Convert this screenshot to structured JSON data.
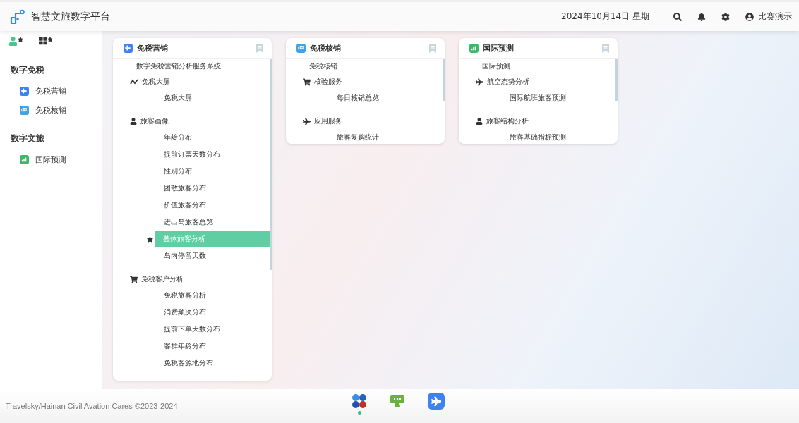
{
  "header": {
    "title": "智慧文旅数字平台",
    "date": "2024年10月14日 星期一",
    "user": "比赛演示"
  },
  "sidebar": {
    "sections": [
      {
        "title": "数字免税",
        "items": [
          {
            "label": "免税营销",
            "kind": "plane"
          },
          {
            "label": "免税核销",
            "kind": "ticket"
          }
        ]
      },
      {
        "title": "数字文旅",
        "items": [
          {
            "label": "国际预测",
            "kind": "chart"
          }
        ]
      }
    ]
  },
  "cards": [
    {
      "title": "免税营销",
      "kind": "plane",
      "system": "数字免税营销分析服务系统",
      "groups": [
        {
          "label": "免税大屏",
          "kind": "line",
          "items": [
            {
              "label": "免税大屏",
              "selected": false
            }
          ]
        },
        {
          "label": "旅客画像",
          "kind": "user",
          "items": [
            {
              "label": "年龄分布",
              "selected": false
            },
            {
              "label": "提前订票天数分布",
              "selected": false
            },
            {
              "label": "性别分布",
              "selected": false
            },
            {
              "label": "团散旅客分布",
              "selected": false
            },
            {
              "label": "价值旅客分布",
              "selected": false
            },
            {
              "label": "进出岛旅客总览",
              "selected": false
            },
            {
              "label": "整体旅客分析",
              "selected": true
            },
            {
              "label": "岛内停留天数",
              "selected": false
            }
          ]
        },
        {
          "label": "免税客户分析",
          "kind": "cart",
          "items": [
            {
              "label": "免税旅客分析",
              "selected": false
            },
            {
              "label": "消费频次分布",
              "selected": false
            },
            {
              "label": "提前下单天数分布",
              "selected": false
            },
            {
              "label": "客群年龄分布",
              "selected": false
            },
            {
              "label": "免税客源地分布",
              "selected": false
            }
          ]
        }
      ]
    },
    {
      "title": "免税核销",
      "kind": "ticket",
      "system": "免税核销",
      "groups": [
        {
          "label": "核验服务",
          "kind": "cart",
          "items": [
            {
              "label": "每日核销总览",
              "selected": false
            }
          ]
        },
        {
          "label": "应用服务",
          "kind": "plane",
          "items": [
            {
              "label": "旅客复购统计",
              "selected": false
            }
          ]
        }
      ]
    },
    {
      "title": "国际预测",
      "kind": "chart",
      "system": "国际预测",
      "groups": [
        {
          "label": "航空态势分析",
          "kind": "plane",
          "items": [
            {
              "label": "国际航班旅客预测",
              "selected": false
            }
          ]
        },
        {
          "label": "旅客结构分析",
          "kind": "user",
          "items": [
            {
              "label": "旅客基础指标预测",
              "selected": false
            }
          ]
        }
      ]
    }
  ],
  "footer": {
    "copyright": "Travelsky/Hainan Civil Avation Cares ©2023-2024",
    "dock": [
      {
        "kind": "clover",
        "selected": true
      },
      {
        "kind": "monitor",
        "selected": false
      },
      {
        "kind": "plane",
        "selected": false
      }
    ]
  }
}
